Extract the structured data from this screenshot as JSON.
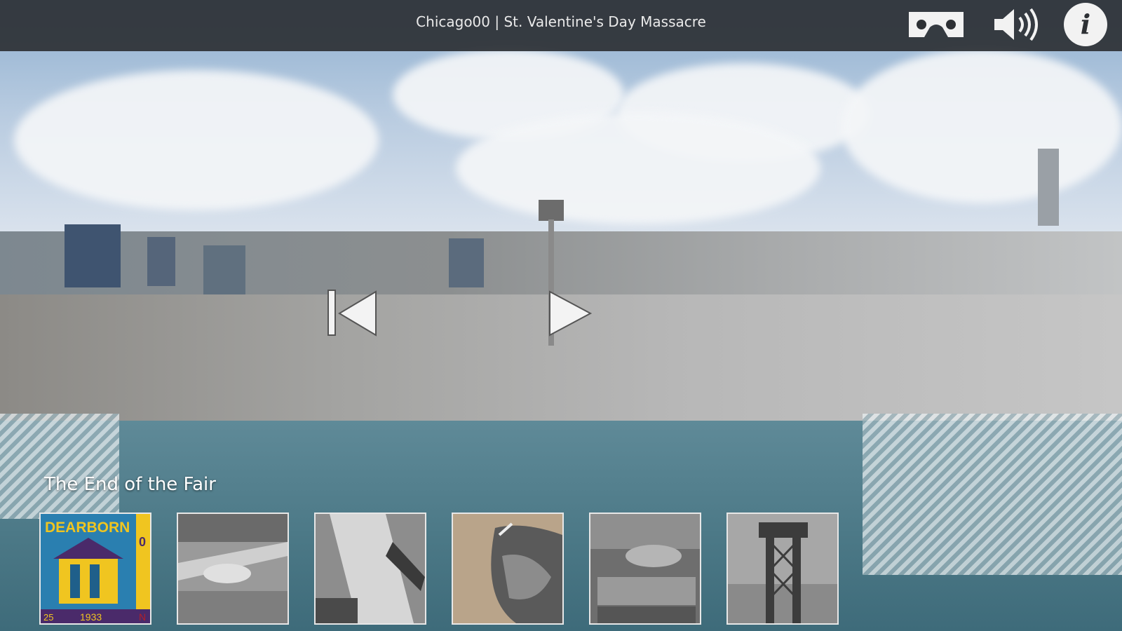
{
  "app": {
    "title": "Chicago00 | St. Valentine's Day Massacre"
  },
  "toolbar": {
    "vr_icon": "cardboard-vr-icon",
    "sound_icon": "speaker-volume-icon",
    "info_icon": "info-icon",
    "info_glyph": "i"
  },
  "navigation": {
    "prev_icon": "previous-arrow-icon",
    "next_icon": "next-arrow-icon"
  },
  "section": {
    "title": "The End of the Fair"
  },
  "thumbnails": [
    {
      "name": "Dearborn stamp",
      "text_top": "DEARBORN",
      "text_bottom": "1933",
      "text_side": "0",
      "text_corner": "N",
      "text_corner2": "25"
    },
    {
      "name": "aerial fairgrounds photo"
    },
    {
      "name": "river bridge photo"
    },
    {
      "name": "lakefront aerial photo"
    },
    {
      "name": "fair district aerial photo"
    },
    {
      "name": "sky ride tower photo"
    }
  ],
  "colors": {
    "topbar": "#2d3034",
    "accent_stamp": "#2a7fb0"
  }
}
